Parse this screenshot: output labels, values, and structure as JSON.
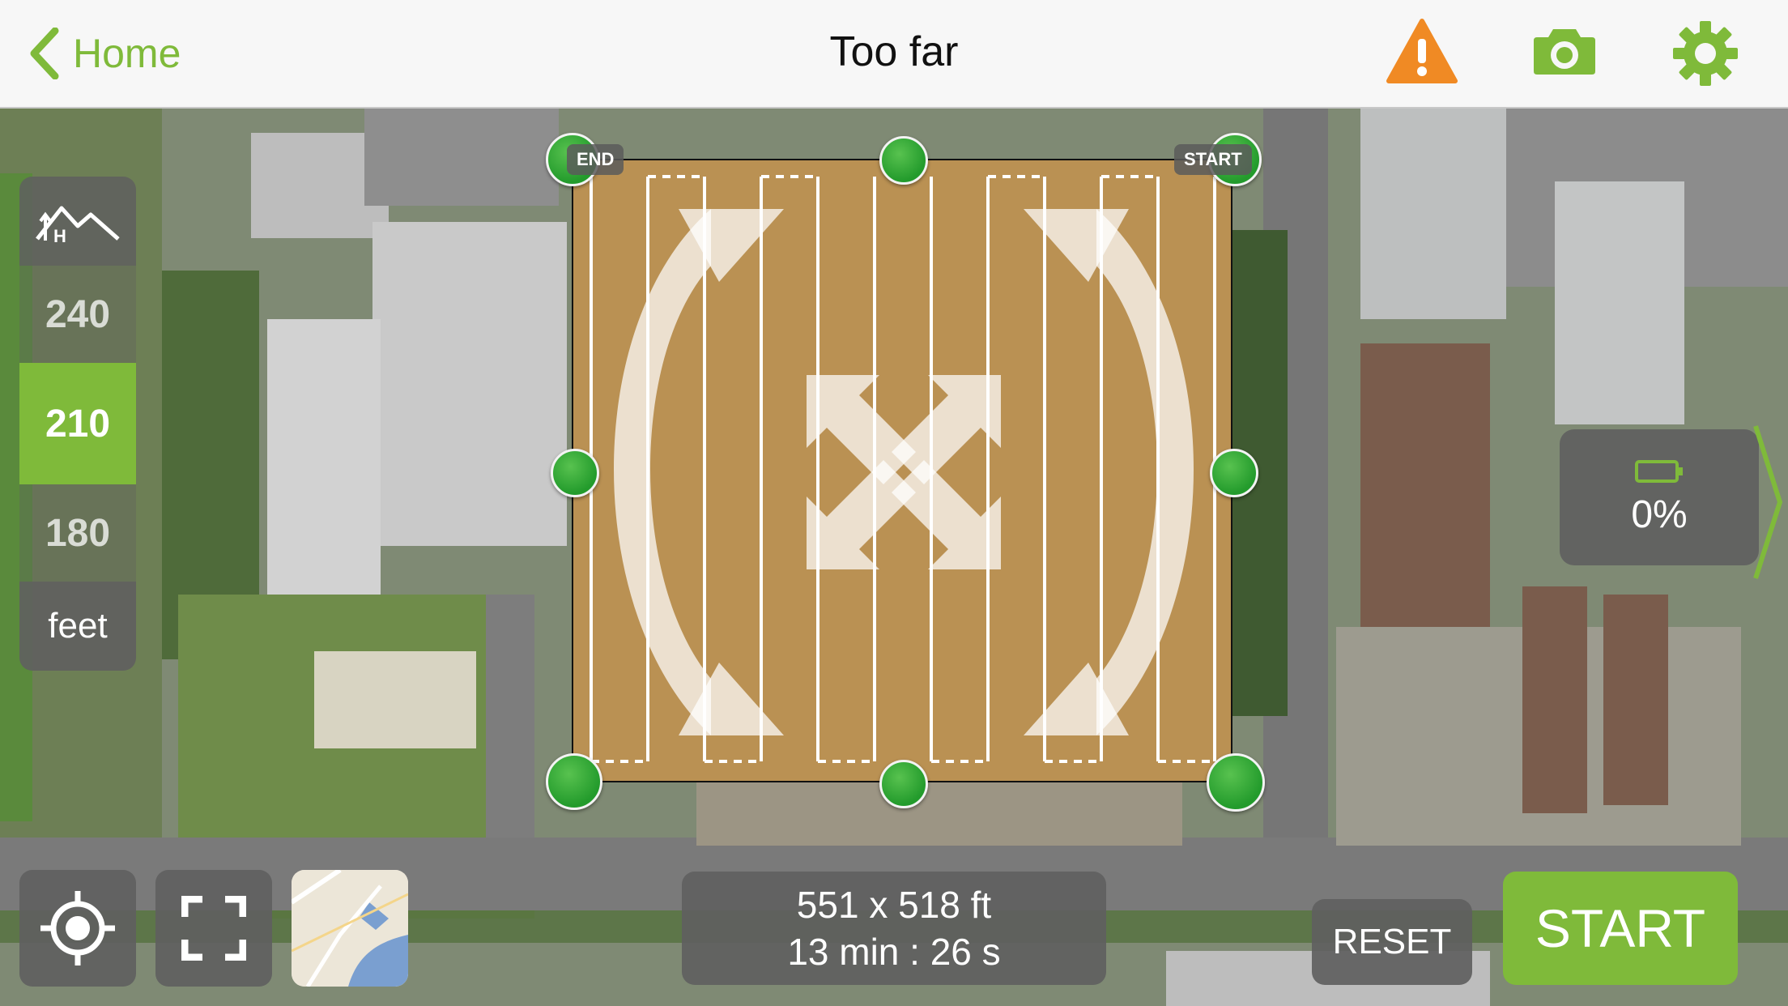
{
  "header": {
    "back_label": "Home",
    "title": "Too far"
  },
  "icons": {
    "back": "chevron-left-icon",
    "warning": "warning-icon",
    "camera": "camera-icon",
    "settings": "gear-icon",
    "altitude": "mountain-height-icon",
    "locate": "crosshair-icon",
    "fit": "fullscreen-icon",
    "battery": "battery-icon"
  },
  "flight_area": {
    "end_label": "END",
    "start_label": "START"
  },
  "altitude": {
    "values": [
      "240",
      "210",
      "180"
    ],
    "selected": "210",
    "unit": "feet"
  },
  "battery": {
    "value": "0%",
    "level": 0
  },
  "info": {
    "dimensions": "551 x 518 ft",
    "duration": "13 min : 26 s"
  },
  "buttons": {
    "reset": "RESET",
    "start": "START"
  },
  "colors": {
    "accent": "#7fba3a",
    "warning": "#f08a24",
    "area_fill": "#e6963c",
    "panel": "#5f5f5f",
    "handle": "#2aa832"
  }
}
